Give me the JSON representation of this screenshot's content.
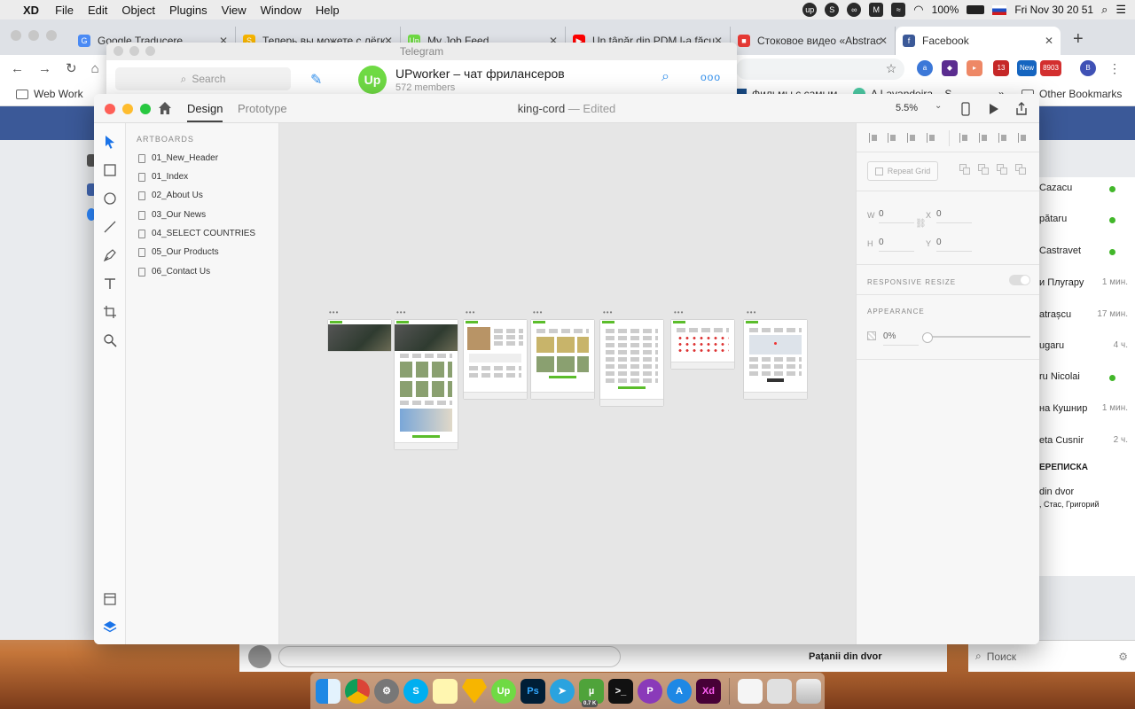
{
  "menubar": {
    "app_name": "XD",
    "items": [
      "File",
      "Edit",
      "Object",
      "Plugins",
      "View",
      "Window",
      "Help"
    ],
    "battery": "100%",
    "datetime": "Fri Nov 30  20 51"
  },
  "chrome": {
    "tabs": [
      {
        "title": "Google Traducere",
        "color": "#4a8af4",
        "icon": "G"
      },
      {
        "title": "Теперь вы можете с лёгк",
        "color": "#f7b500",
        "icon": "S"
      },
      {
        "title": "My Job Feed",
        "color": "#6fda44",
        "icon": "Up"
      },
      {
        "title": "Un tânăr din PDM l-a făcu",
        "color": "#ff0000",
        "icon": "▶"
      },
      {
        "title": "Стоковое видео «Abstrac",
        "color": "#e53935",
        "icon": "■"
      },
      {
        "title": "Facebook",
        "color": "#3b5998",
        "icon": "f"
      }
    ],
    "ext_badges": {
      "e1": "13",
      "e2": "New",
      "e3": "8903"
    },
    "profile_initial": "B",
    "bookmarks": {
      "web_work": "Web Work",
      "films": "Фильмы с самым...",
      "lavandeira": "A Lavandeira – S...",
      "more": "»",
      "other": "Other Bookmarks"
    }
  },
  "facebook": {
    "contacts": [
      {
        "name": "Cazacu",
        "time": "",
        "online": true
      },
      {
        "name": "pătaru",
        "time": "",
        "online": true
      },
      {
        "name": "Castravet",
        "time": "",
        "online": true
      },
      {
        "name": "и Плугару",
        "time": "1 мин.",
        "online": false
      },
      {
        "name": "atrașcu",
        "time": "17 мин.",
        "online": false
      },
      {
        "name": "ugaru",
        "time": "4 ч.",
        "online": false
      },
      {
        "name": "ru Nicolai",
        "time": "",
        "online": true
      },
      {
        "name": "на Кушнир",
        "time": "1 мин.",
        "online": false
      },
      {
        "name": "eta Cusnir",
        "time": "2 ч.",
        "online": false
      }
    ],
    "section_title": "ЕРЕПИСКА",
    "group_name": "din dvor",
    "group_members": ", Стас, Григорий",
    "chat_footer_name": "Pațanii din dvor",
    "search_placeholder": "Поиск"
  },
  "telegram": {
    "window_title": "Telegram",
    "search_placeholder": "Search",
    "chat_name": "UPworker – чат фрилансеров",
    "members": "572 members",
    "avatar_text": "Up"
  },
  "xd": {
    "tabs": {
      "design": "Design",
      "prototype": "Prototype"
    },
    "doc_name": "king-cord",
    "doc_sep": "—",
    "doc_status": "Edited",
    "zoom": "5.5%",
    "artboards_header": "ARTBOARDS",
    "artboards": [
      "01_New_Header",
      "01_Index",
      "02_About Us",
      "03_Our News",
      "04_SELECT COUNTRIES",
      "05_Our Products",
      "06_Contact Us"
    ],
    "artboard_more": "•••",
    "repeat_grid": "Repeat Grid",
    "w_label": "W",
    "w_value": "0",
    "x_label": "X",
    "x_value": "0",
    "h_label": "H",
    "h_value": "0",
    "y_label": "Y",
    "y_value": "0",
    "responsive_resize": "RESPONSIVE RESIZE",
    "appearance": "APPEARANCE",
    "opacity": "0%"
  },
  "dock": {
    "utorrent_badge": "0.7 K",
    "xd_label": "Xd",
    "ps_label": "Ps",
    "upwork_label": "Up"
  }
}
